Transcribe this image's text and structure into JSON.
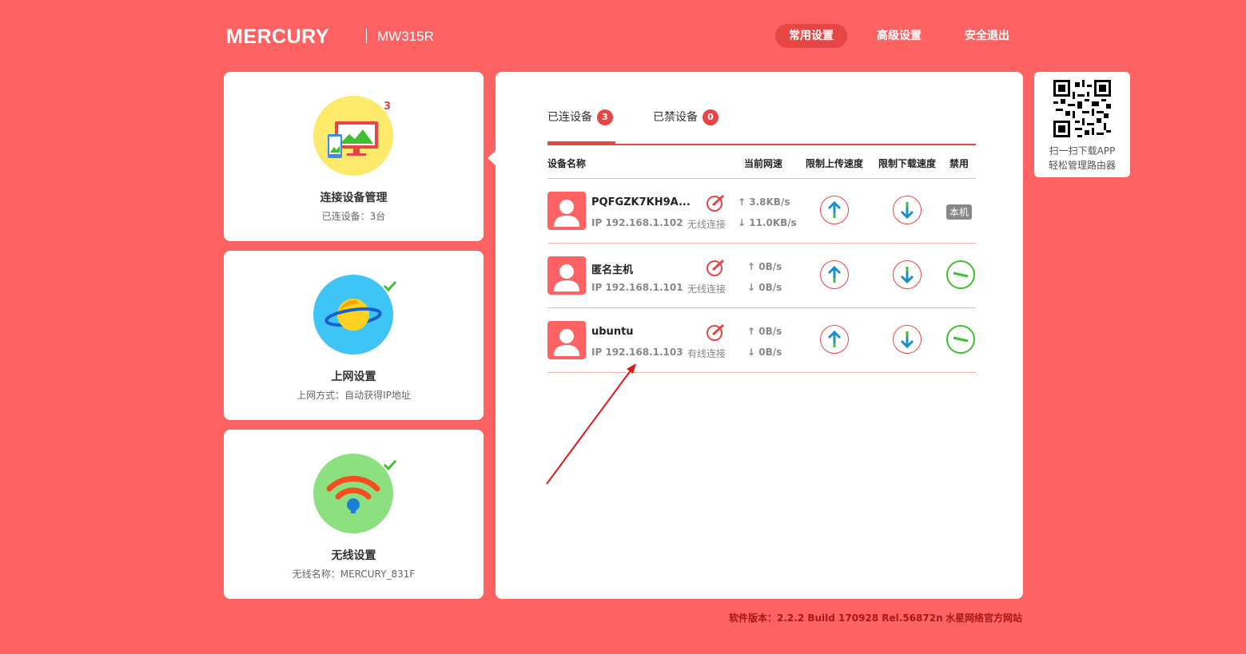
{
  "header": {
    "brand": "MERCURY",
    "model": "MW315R",
    "nav": [
      "常用设置",
      "高级设置",
      "安全退出"
    ]
  },
  "cards": [
    {
      "title": "连接设备管理",
      "subtitle": "已连设备：3台",
      "badge": "3"
    },
    {
      "title": "上网设置",
      "subtitle": "上网方式：自动获得IP地址"
    },
    {
      "title": "无线设置",
      "subtitle": "无线名称：MERCURY_831F"
    }
  ],
  "tabs": [
    {
      "label": "已连设备",
      "count": "3"
    },
    {
      "label": "已禁设备",
      "count": "0"
    }
  ],
  "columns": [
    "设备名称",
    "当前网速",
    "限制上传速度",
    "限制下载速度",
    "禁用"
  ],
  "devices": [
    {
      "name": "PQFGZK7KH9A...",
      "ip": "IP 192.168.1.102",
      "conn": "无线连接",
      "up": "3.8KB/s",
      "down": "11.0KB/s",
      "status": "本机"
    },
    {
      "name": "匿名主机",
      "ip": "IP 192.168.1.101",
      "conn": "无线连接",
      "up": "0B/s",
      "down": "0B/s"
    },
    {
      "name": "ubuntu",
      "ip": "IP 192.168.1.103",
      "conn": "有线连接",
      "up": "0B/s",
      "down": "0B/s"
    }
  ],
  "qr": {
    "line1": "扫一扫下载APP",
    "line2": "轻松管理路由器"
  },
  "footer": {
    "version": "软件版本：2.2.2 Build 170928 Rel.56872n",
    "site": "水星网络官方网站"
  },
  "colors": {
    "background": "#fe6262",
    "accent": "#e84545",
    "green": "#3fbf2f"
  }
}
